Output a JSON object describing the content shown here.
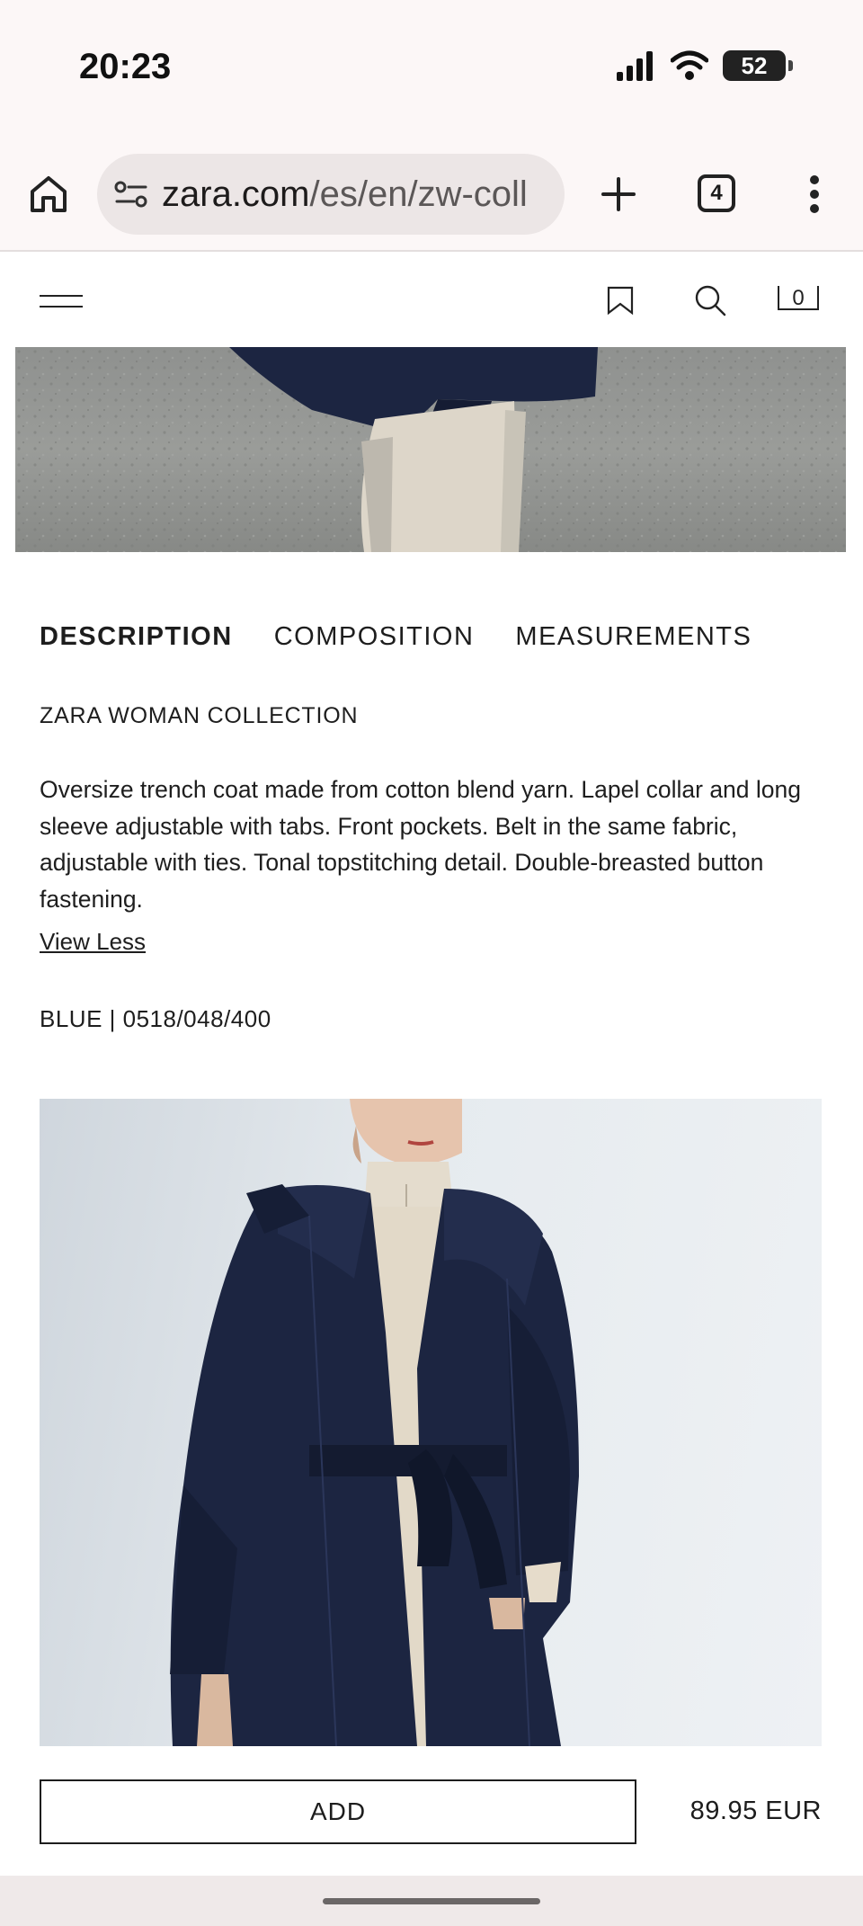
{
  "status_bar": {
    "time": "20:23",
    "battery": "52",
    "icons": [
      "signal-icon",
      "wifi-icon",
      "battery-icon"
    ]
  },
  "browser": {
    "url_domain": "zara.com",
    "url_path": "/es/en/zw-coll",
    "tab_count": "4",
    "icons": [
      "home-icon",
      "site-settings-icon",
      "plus-icon",
      "more-vert-icon"
    ]
  },
  "header": {
    "cart_count": "0",
    "icons": [
      "menu-icon",
      "bookmark-icon",
      "search-icon",
      "bag-icon"
    ]
  },
  "tabs": [
    {
      "label": "DESCRIPTION",
      "active": true
    },
    {
      "label": "COMPOSITION",
      "active": false
    },
    {
      "label": "MEASUREMENTS",
      "active": false
    }
  ],
  "product": {
    "collection": "ZARA WOMAN COLLECTION",
    "description": "Oversize trench coat made from cotton blend yarn. Lapel collar and long sleeve adjustable with tabs. Front pockets. Belt in the same fabric, adjustable with ties. Tonal topstitching detail. Double-breasted button fastening.",
    "view_less": "View Less",
    "color_ref": "BLUE | 0518/048/400",
    "add_label": "ADD",
    "price": "89.95 EUR",
    "coat_color": "#1c2541",
    "trousers_color": "#e4ddcf"
  }
}
